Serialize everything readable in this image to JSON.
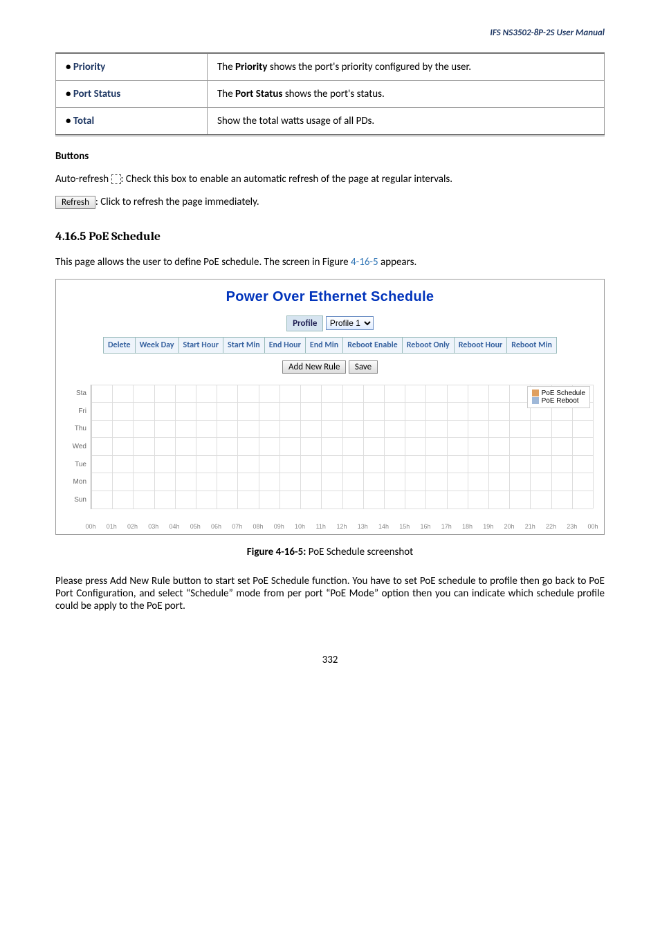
{
  "header": {
    "manual": "IFS  NS3502-8P-2S  User  Manual"
  },
  "infobox": {
    "rows": [
      {
        "label": "Priority",
        "text_a": "The ",
        "text_b": "Priority",
        "text_c": " shows the port's priority configured by the user."
      },
      {
        "label": "Port Status",
        "text_a": "The ",
        "text_b": "Port Status",
        "text_c": " shows the port's status."
      },
      {
        "label": "Total",
        "text_a": "",
        "text_b": "",
        "text_c": "Show the total watts usage of all PDs."
      }
    ]
  },
  "buttons_section": {
    "title": "Buttons",
    "auto_refresh_a": "Auto-refresh  ",
    "auto_refresh_b": ": Check this box to enable an automatic refresh of the page at regular intervals.",
    "refresh_btn": "Refresh",
    "refresh_text": ": Click to refresh the page immediately."
  },
  "section": {
    "heading": "4.16.5 PoE Schedule",
    "intro_a": "This page allows the user to define PoE schedule. The screen in Figure ",
    "intro_link": "4-16-5",
    "intro_b": " appears."
  },
  "poe": {
    "title": "Power Over Ethernet Schedule",
    "profile_label": "Profile",
    "profile_value": "Profile 1",
    "columns": [
      "Delete",
      "Week Day",
      "Start Hour",
      "Start Min",
      "End Hour",
      "End Min",
      "Reboot Enable",
      "Reboot Only",
      "Reboot Hour",
      "Reboot Min"
    ],
    "btn_add": "Add New Rule",
    "btn_save": "Save",
    "legend_a": "PoE Schedule",
    "legend_b": "PoE Reboot"
  },
  "chart_data": {
    "type": "heatmap",
    "title": "",
    "categories_y": [
      "Sta",
      "Fri",
      "Thu",
      "Wed",
      "Tue",
      "Mon",
      "Sun"
    ],
    "categories_x": [
      "00h",
      "01h",
      "02h",
      "03h",
      "04h",
      "05h",
      "06h",
      "07h",
      "08h",
      "09h",
      "10h",
      "11h",
      "12h",
      "13h",
      "14h",
      "15h",
      "16h",
      "17h",
      "18h",
      "19h",
      "20h",
      "21h",
      "22h",
      "23h",
      "00h"
    ],
    "series": [
      {
        "name": "PoE Schedule",
        "values": []
      },
      {
        "name": "PoE Reboot",
        "values": []
      }
    ],
    "xlabel": "",
    "ylabel": "",
    "legend_position": "top-right",
    "grid": true,
    "note": "Empty schedule — no cells filled in screenshot"
  },
  "figure_caption": {
    "a": "Figure 4-16-5: ",
    "b": "PoE Schedule screenshot"
  },
  "paragraph": "Please press Add New Rule button to start set PoE Schedule function. You have to set PoE schedule to profile then go back to PoE Port Configuration, and select “Schedule” mode from per port “PoE Mode” option then you can indicate which schedule profile could be apply to the PoE port.",
  "page_num": "332"
}
